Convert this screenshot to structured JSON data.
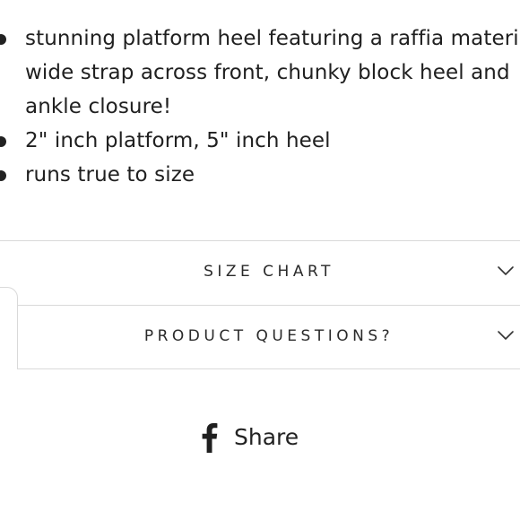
{
  "product_details": {
    "bullets": [
      {
        "lines": [
          "stunning platform heel featuring a raffia material,",
          "wide strap across front, chunky block heel and",
          "ankle closure!"
        ]
      },
      {
        "lines": [
          "2\" inch platform, 5\" inch heel"
        ]
      },
      {
        "lines": [
          "runs true to size"
        ]
      }
    ]
  },
  "accordions": [
    {
      "label": "SIZE CHART",
      "icon": "chevron-down-icon"
    },
    {
      "label": "PRODUCT QUESTIONS?",
      "icon": "chevron-down-icon"
    }
  ],
  "share": {
    "label": "Share",
    "icon": "facebook-icon"
  }
}
